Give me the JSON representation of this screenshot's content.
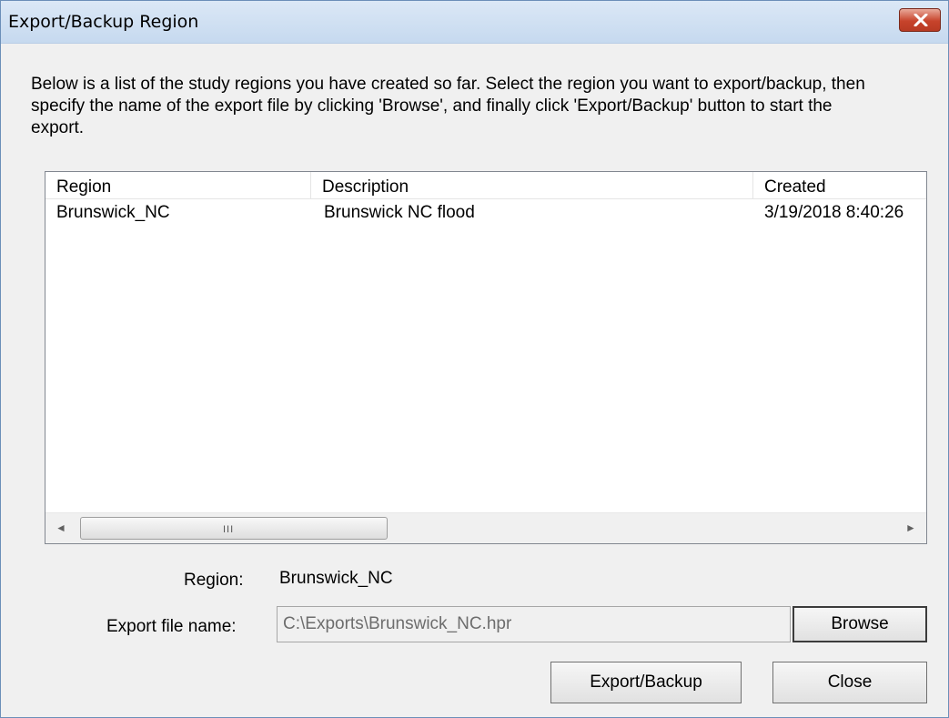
{
  "window": {
    "title": "Export/Backup Region",
    "close_icon": "close-icon"
  },
  "instructions": "Below is a list of the study regions you have created so far.  Select the region you want to export/backup, then specify the name of the export file by clicking 'Browse', and finally click 'Export/Backup' button to start the export.",
  "table": {
    "columns": [
      "Region",
      "Description",
      "Created"
    ],
    "rows": [
      [
        "Brunswick_NC",
        "Brunswick NC flood",
        "3/19/2018 8:40:26"
      ]
    ]
  },
  "scrollbar": {
    "left_arrow": "◄",
    "right_arrow": "►",
    "grip": "III"
  },
  "form": {
    "region_label": "Region:",
    "region_value": "Brunswick_NC",
    "export_label": "Export file name:",
    "export_value": "C:\\Exports\\Brunswick_NC.hpr"
  },
  "buttons": {
    "browse": "Browse",
    "export_backup": "Export/Backup",
    "close": "Close"
  }
}
